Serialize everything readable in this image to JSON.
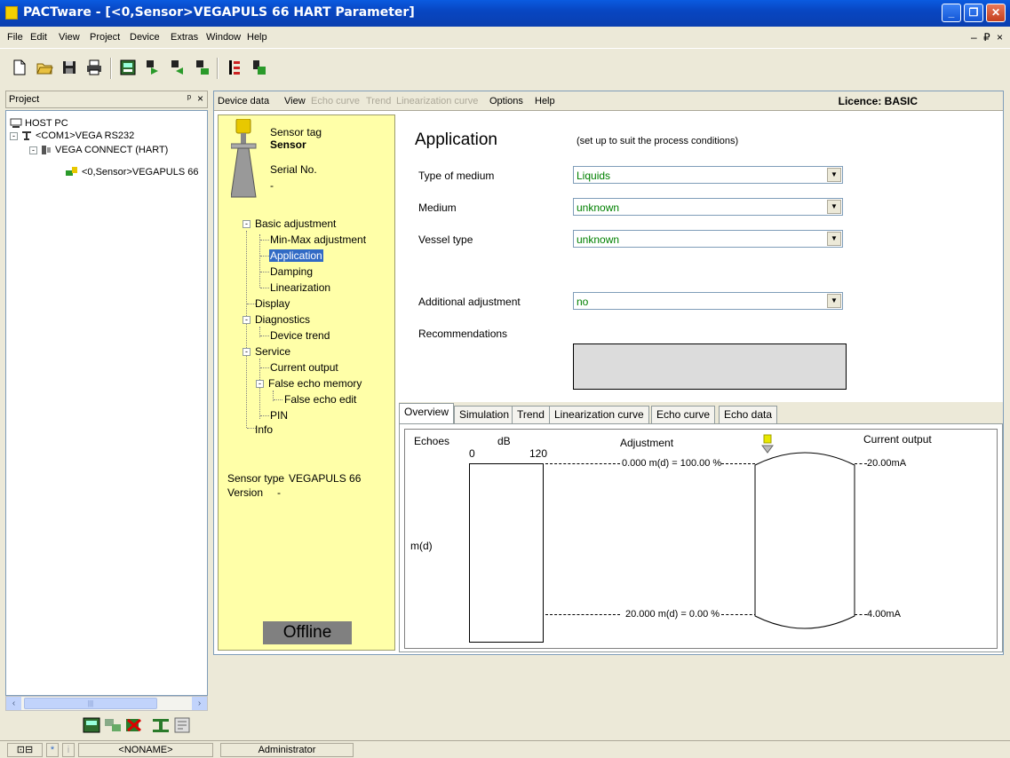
{
  "window": {
    "title": "PACTware - [<0,Sensor>VEGAPULS 66 HART Parameter]"
  },
  "menubar": {
    "items": [
      "File",
      "Edit",
      "View",
      "Project",
      "Device",
      "Extras",
      "Window",
      "Help"
    ],
    "mdi_controls": "– ₽ ×"
  },
  "project_panel": {
    "title": "Project",
    "pin": "ᵖ",
    "close": "×",
    "tree": [
      {
        "label": "HOST PC"
      },
      {
        "label": "<COM1>VEGA RS232"
      },
      {
        "label": "VEGA CONNECT (HART)"
      },
      {
        "label": "<0,Sensor>VEGAPULS 66"
      }
    ]
  },
  "statusbar": {
    "project_name": "<NONAME>",
    "user": "Administrator"
  },
  "device_menu": {
    "items": [
      "Device data",
      "View",
      "Echo curve",
      "Trend",
      "Linearization curve",
      "Options",
      "Help"
    ],
    "licence": "Licence: BASIC"
  },
  "nav": {
    "sensor_tag_label": "Sensor tag",
    "sensor_tag_value": "Sensor",
    "serial_label": "Serial No.",
    "serial_value": "-",
    "items": [
      "Basic adjustment",
      "Min-Max adjustment",
      "Application",
      "Damping",
      "Linearization",
      "Display",
      "Diagnostics",
      "Device trend",
      "Service",
      "Current output",
      "False echo memory",
      "False echo edit",
      "PIN",
      "Info"
    ],
    "sensor_type_label": "Sensor type",
    "sensor_type_value": "VEGAPULS 66",
    "version_label": "Version",
    "version_value": "-",
    "status": "Offline"
  },
  "application": {
    "heading": "Application",
    "subtitle": "(set up to suit the process conditions)",
    "fields": [
      {
        "label": "Type of medium",
        "value": "Liquids"
      },
      {
        "label": "Medium",
        "value": "unknown"
      },
      {
        "label": "Vessel type",
        "value": "unknown"
      },
      {
        "label": "Additional adjustment",
        "value": "no"
      }
    ],
    "recommendations_label": "Recommendations"
  },
  "tabs": [
    "Overview",
    "Simulation",
    "Trend",
    "Linearization curve",
    "Echo curve",
    "Echo data"
  ],
  "overview": {
    "echoes_label": "Echoes",
    "db_label": "dB",
    "db_min": "0",
    "db_max": "120",
    "adjustment_label": "Adjustment",
    "current_output_label": "Current output",
    "max_adjust": "0.000 m(d) = 100.00 %",
    "min_adjust": "20.000 m(d) = 0.00 %",
    "current_max": "20.00mA",
    "current_min": "4.00mA",
    "axis_label": "m(d)"
  }
}
